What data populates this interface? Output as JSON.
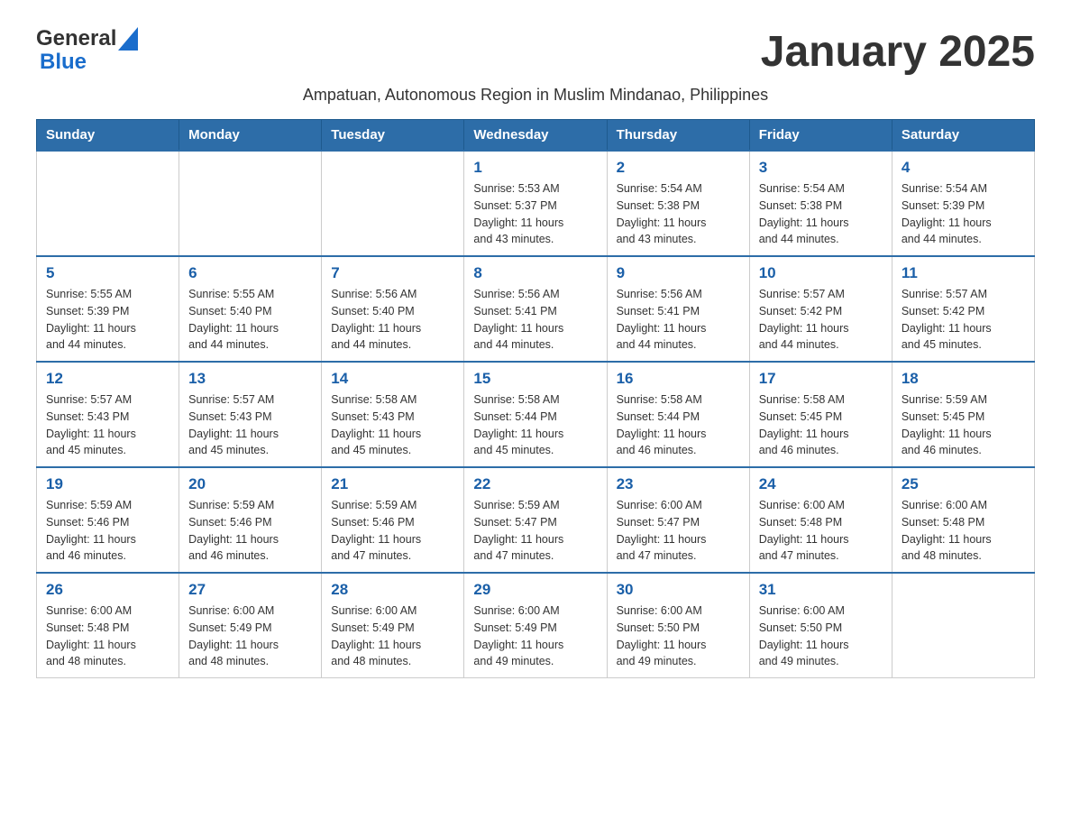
{
  "header": {
    "logo_general": "General",
    "logo_blue": "Blue",
    "month_title": "January 2025",
    "subtitle": "Ampatuan, Autonomous Region in Muslim Mindanao, Philippines"
  },
  "weekdays": [
    "Sunday",
    "Monday",
    "Tuesday",
    "Wednesday",
    "Thursday",
    "Friday",
    "Saturday"
  ],
  "weeks": [
    {
      "days": [
        {
          "number": "",
          "info": ""
        },
        {
          "number": "",
          "info": ""
        },
        {
          "number": "",
          "info": ""
        },
        {
          "number": "1",
          "info": "Sunrise: 5:53 AM\nSunset: 5:37 PM\nDaylight: 11 hours\nand 43 minutes."
        },
        {
          "number": "2",
          "info": "Sunrise: 5:54 AM\nSunset: 5:38 PM\nDaylight: 11 hours\nand 43 minutes."
        },
        {
          "number": "3",
          "info": "Sunrise: 5:54 AM\nSunset: 5:38 PM\nDaylight: 11 hours\nand 44 minutes."
        },
        {
          "number": "4",
          "info": "Sunrise: 5:54 AM\nSunset: 5:39 PM\nDaylight: 11 hours\nand 44 minutes."
        }
      ]
    },
    {
      "days": [
        {
          "number": "5",
          "info": "Sunrise: 5:55 AM\nSunset: 5:39 PM\nDaylight: 11 hours\nand 44 minutes."
        },
        {
          "number": "6",
          "info": "Sunrise: 5:55 AM\nSunset: 5:40 PM\nDaylight: 11 hours\nand 44 minutes."
        },
        {
          "number": "7",
          "info": "Sunrise: 5:56 AM\nSunset: 5:40 PM\nDaylight: 11 hours\nand 44 minutes."
        },
        {
          "number": "8",
          "info": "Sunrise: 5:56 AM\nSunset: 5:41 PM\nDaylight: 11 hours\nand 44 minutes."
        },
        {
          "number": "9",
          "info": "Sunrise: 5:56 AM\nSunset: 5:41 PM\nDaylight: 11 hours\nand 44 minutes."
        },
        {
          "number": "10",
          "info": "Sunrise: 5:57 AM\nSunset: 5:42 PM\nDaylight: 11 hours\nand 44 minutes."
        },
        {
          "number": "11",
          "info": "Sunrise: 5:57 AM\nSunset: 5:42 PM\nDaylight: 11 hours\nand 45 minutes."
        }
      ]
    },
    {
      "days": [
        {
          "number": "12",
          "info": "Sunrise: 5:57 AM\nSunset: 5:43 PM\nDaylight: 11 hours\nand 45 minutes."
        },
        {
          "number": "13",
          "info": "Sunrise: 5:57 AM\nSunset: 5:43 PM\nDaylight: 11 hours\nand 45 minutes."
        },
        {
          "number": "14",
          "info": "Sunrise: 5:58 AM\nSunset: 5:43 PM\nDaylight: 11 hours\nand 45 minutes."
        },
        {
          "number": "15",
          "info": "Sunrise: 5:58 AM\nSunset: 5:44 PM\nDaylight: 11 hours\nand 45 minutes."
        },
        {
          "number": "16",
          "info": "Sunrise: 5:58 AM\nSunset: 5:44 PM\nDaylight: 11 hours\nand 46 minutes."
        },
        {
          "number": "17",
          "info": "Sunrise: 5:58 AM\nSunset: 5:45 PM\nDaylight: 11 hours\nand 46 minutes."
        },
        {
          "number": "18",
          "info": "Sunrise: 5:59 AM\nSunset: 5:45 PM\nDaylight: 11 hours\nand 46 minutes."
        }
      ]
    },
    {
      "days": [
        {
          "number": "19",
          "info": "Sunrise: 5:59 AM\nSunset: 5:46 PM\nDaylight: 11 hours\nand 46 minutes."
        },
        {
          "number": "20",
          "info": "Sunrise: 5:59 AM\nSunset: 5:46 PM\nDaylight: 11 hours\nand 46 minutes."
        },
        {
          "number": "21",
          "info": "Sunrise: 5:59 AM\nSunset: 5:46 PM\nDaylight: 11 hours\nand 47 minutes."
        },
        {
          "number": "22",
          "info": "Sunrise: 5:59 AM\nSunset: 5:47 PM\nDaylight: 11 hours\nand 47 minutes."
        },
        {
          "number": "23",
          "info": "Sunrise: 6:00 AM\nSunset: 5:47 PM\nDaylight: 11 hours\nand 47 minutes."
        },
        {
          "number": "24",
          "info": "Sunrise: 6:00 AM\nSunset: 5:48 PM\nDaylight: 11 hours\nand 47 minutes."
        },
        {
          "number": "25",
          "info": "Sunrise: 6:00 AM\nSunset: 5:48 PM\nDaylight: 11 hours\nand 48 minutes."
        }
      ]
    },
    {
      "days": [
        {
          "number": "26",
          "info": "Sunrise: 6:00 AM\nSunset: 5:48 PM\nDaylight: 11 hours\nand 48 minutes."
        },
        {
          "number": "27",
          "info": "Sunrise: 6:00 AM\nSunset: 5:49 PM\nDaylight: 11 hours\nand 48 minutes."
        },
        {
          "number": "28",
          "info": "Sunrise: 6:00 AM\nSunset: 5:49 PM\nDaylight: 11 hours\nand 48 minutes."
        },
        {
          "number": "29",
          "info": "Sunrise: 6:00 AM\nSunset: 5:49 PM\nDaylight: 11 hours\nand 49 minutes."
        },
        {
          "number": "30",
          "info": "Sunrise: 6:00 AM\nSunset: 5:50 PM\nDaylight: 11 hours\nand 49 minutes."
        },
        {
          "number": "31",
          "info": "Sunrise: 6:00 AM\nSunset: 5:50 PM\nDaylight: 11 hours\nand 49 minutes."
        },
        {
          "number": "",
          "info": ""
        }
      ]
    }
  ]
}
